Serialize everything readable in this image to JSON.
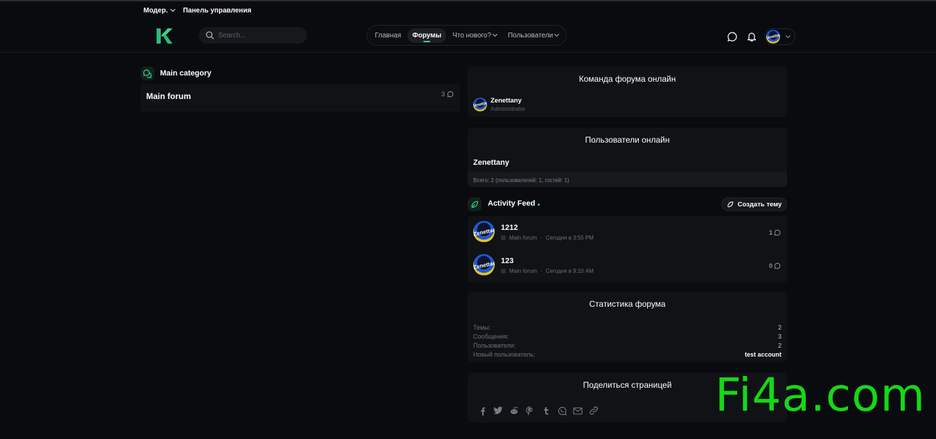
{
  "adminbar": {
    "mod_label": "Модер.",
    "panel_label": "Панель управления"
  },
  "header": {
    "search_placeholder": "Search...",
    "nav": {
      "home": "Главная",
      "forums": "Форумы",
      "whats_new": "Что нового?",
      "members": "Пользователи"
    },
    "avatar_text": "Zenettany"
  },
  "category": {
    "title": "Main category"
  },
  "forum": {
    "title": "Main forum",
    "count": "3"
  },
  "staff_block": {
    "title": "Команда форума онлайн",
    "name": "Zenettany",
    "role": "Administrator"
  },
  "online_block": {
    "title": "Пользователи онлайн",
    "user": "Zenettany",
    "footer": "Всего: 2 (пользователей: 1, гостей: 1)"
  },
  "feed": {
    "title": "Activity Feed",
    "new_thread": "Создать тему",
    "items": [
      {
        "title": "1212",
        "forum": "Main forum",
        "time": "Сегодня в 3:55 PM",
        "count": "1",
        "avatar_text": "Zenettany"
      },
      {
        "title": "123",
        "forum": "Main forum",
        "time": "Сегодня в 9:10 AM",
        "count": "0",
        "avatar_text": "Zenettany"
      }
    ]
  },
  "stats": {
    "title": "Статистика форума",
    "rows": [
      {
        "label": "Темы:",
        "value": "2"
      },
      {
        "label": "Сообщения:",
        "value": "3"
      },
      {
        "label": "Пользователи:",
        "value": "2"
      },
      {
        "label": "Новый пользователь:",
        "value": "test account"
      }
    ]
  },
  "share": {
    "title": "Поделиться страницей",
    "icons": [
      "facebook-icon",
      "twitter-icon",
      "reddit-icon",
      "pinterest-icon",
      "tumblr-icon",
      "whatsapp-icon",
      "email-icon",
      "link-icon"
    ]
  },
  "watermark": "Fi4a.com",
  "colors": {
    "accent": "#3bd18a",
    "background": "#0a0b0e",
    "panel": "#111215",
    "watermark": "#14d914"
  }
}
